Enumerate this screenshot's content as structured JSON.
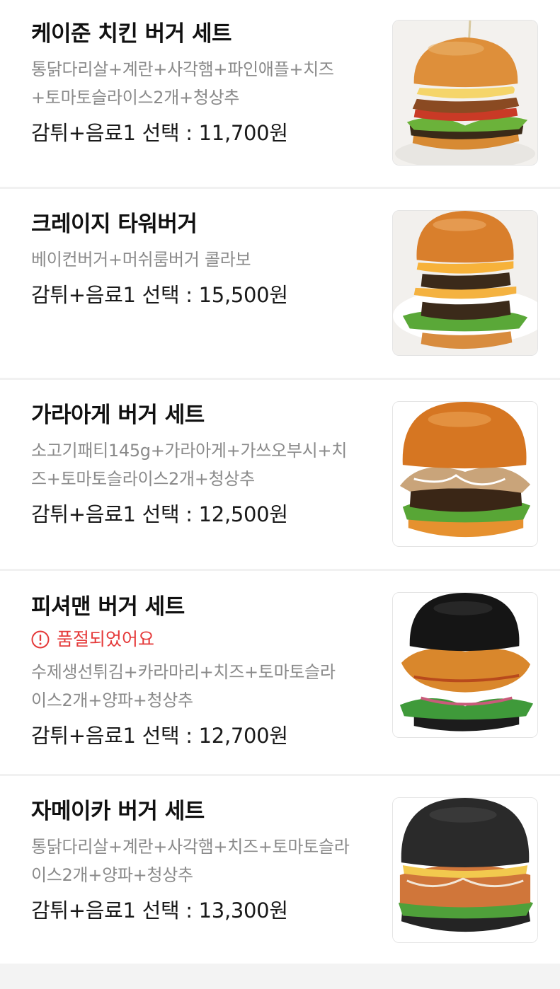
{
  "menu": {
    "items": [
      {
        "name": "케이준 치킨 버거 세트",
        "desc_lines": [
          "통닭다리살+계란+사각햄+파인애플+치즈",
          "+토마토슬라이스2개+청상추"
        ],
        "price": "감튀+음료1 선택 : 11,700원",
        "image_icon": "burger-photo",
        "sold_out": false
      },
      {
        "name": "크레이지 타워버거",
        "desc_lines": [
          "베이컨버거+머쉬룸버거 콜라보"
        ],
        "price": "감튀+음료1 선택 : 15,500원",
        "image_icon": "burger-photo",
        "sold_out": false
      },
      {
        "name": "가라아게 버거 세트",
        "desc_lines": [
          "소고기패티145g+가라아게+가쓰오부시+치",
          "즈+토마토슬라이스2개+청상추"
        ],
        "price": "감튀+음료1 선택 : 12,500원",
        "image_icon": "burger-photo",
        "sold_out": false
      },
      {
        "name": "피셔맨 버거 세트",
        "sold_out_text": "품절되었어요",
        "desc_lines": [
          "수제생선튀김+카라마리+치즈+토마토슬라",
          "이스2개+양파+청상추"
        ],
        "price": "감튀+음료1 선택 : 12,700원",
        "image_icon": "burger-photo",
        "sold_out": true
      },
      {
        "name": "자메이카 버거 세트",
        "desc_lines": [
          "통닭다리살+계란+사각햄+치즈+토마토슬라",
          "이스2개+양파+청상추"
        ],
        "price": "감튀+음료1 선택 : 13,300원",
        "image_icon": "burger-photo",
        "sold_out": false
      }
    ]
  },
  "colors": {
    "sold_out": "#e53b3b",
    "desc_text": "#8a8a8a",
    "divider": "#f1f1f1"
  }
}
